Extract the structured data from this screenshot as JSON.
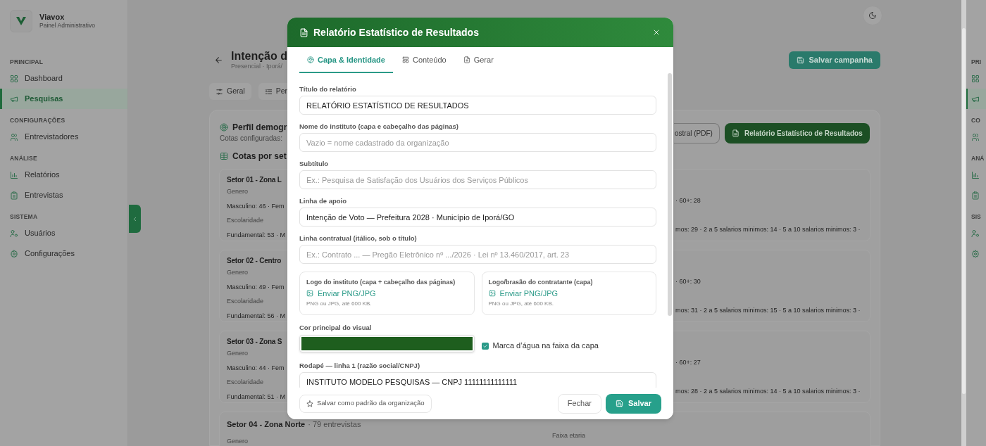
{
  "brand": {
    "name": "Viavox",
    "subtitle": "Painel Administrativo"
  },
  "sidebar": {
    "sections": [
      {
        "title": "PRINCIPAL",
        "items": [
          {
            "label": "Dashboard",
            "selected": false
          },
          {
            "label": "Pesquisas",
            "selected": true
          }
        ]
      },
      {
        "title": "CONFIGURAÇÕES",
        "items": [
          {
            "label": "Entrevistadores",
            "selected": false
          }
        ]
      },
      {
        "title": "ANÁLISE",
        "items": [
          {
            "label": "Relatórios",
            "selected": false
          },
          {
            "label": "Entrevistas",
            "selected": false
          }
        ]
      },
      {
        "title": "SISTEMA",
        "items": [
          {
            "label": "Usuários",
            "selected": false
          },
          {
            "label": "Configurações",
            "selected": false
          }
        ]
      }
    ]
  },
  "right_edge": {
    "sections": [
      {
        "title": "PRI",
        "items": [
          {
            "selected": false
          },
          {
            "selected": true
          }
        ]
      },
      {
        "title": "CO",
        "items": [
          {
            "selected": false
          }
        ]
      },
      {
        "title": "ANÁ",
        "items": [
          {
            "selected": false
          },
          {
            "selected": false
          }
        ]
      },
      {
        "title": "SIS",
        "items": [
          {
            "selected": false
          },
          {
            "selected": false
          }
        ]
      }
    ]
  },
  "page": {
    "title": "Intenção d",
    "subtitle": "Presencial · Iporá/",
    "save_button": "Salvar campanha",
    "tabs": [
      {
        "label": "Geral"
      },
      {
        "label": "Per"
      }
    ],
    "card": {
      "title": "Perfil demogr",
      "subtitle": "Cotas configuradas:",
      "pdf_button": "ostral (PDF)",
      "report_button": "Relatório Estatístico de Resultados",
      "section_title": "Cotas por set",
      "sectors": [
        {
          "kind": "split",
          "title": "Setor 01 - Zona L",
          "gender_label": "Genero",
          "gender_values": "Masculino: 46 · Fem",
          "age_values_tail": "· 60+: 28",
          "education_label": "Escolaridade",
          "education_values": "Fundamental: 53 · M",
          "education_values_tail": "mos: 29 · 2 a 5 salarios minimos: 14 · 5 a 10 salarios minimos: 3 ·"
        },
        {
          "kind": "split",
          "title": "Setor 02 - Centro",
          "gender_label": "Genero",
          "gender_values": "Masculino: 49 · Fem",
          "age_values_tail": "· 60+: 30",
          "education_label": "Escolaridade",
          "education_values": "Fundamental: 56 · M",
          "education_values_tail": "mos: 31 · 2 a 5 salarios minimos: 15 · 5 a 10 salarios minimos: 3 ·"
        },
        {
          "kind": "split",
          "title": "Setor 03 - Zona S",
          "gender_label": "Genero",
          "gender_values": "Masculino: 44 · Fem",
          "age_values_tail": "· 60+: 27",
          "education_label": "Escolaridade",
          "education_values": "Fundamental: 51 · M",
          "education_values_tail": "mos: 28 · 2 a 5 salarios minimos: 14 · 5 a 10 salarios minimos: 3 ·"
        },
        {
          "kind": "below",
          "title": "Setor 04 - Zona Norte",
          "count": "· 79 entrevistas",
          "gender_label": "Genero",
          "age_label": "Faixa etaria"
        }
      ]
    }
  },
  "modal": {
    "title": "Relatório Estatístico de Resultados",
    "tabs": [
      {
        "label": "Capa & Identidade",
        "selected": true
      },
      {
        "label": "Conteúdo",
        "selected": false
      },
      {
        "label": "Gerar",
        "selected": false
      }
    ],
    "fields": [
      {
        "label": "Título do relatório",
        "value": "RELATÓRIO ESTATÍSTICO DE RESULTADOS"
      },
      {
        "label": "Nome do instituto (capa e cabeçalho das páginas)",
        "placeholder": "Vazio = nome cadastrado da organização"
      },
      {
        "label": "Subtítulo",
        "placeholder": "Ex.: Pesquisa de Satisfação dos Usuários dos Serviços Públicos"
      },
      {
        "label": "Linha de apoio",
        "value": "Intenção de Voto — Prefeitura 2028 · Município de Iporá/GO"
      },
      {
        "label": "Linha contratual (itálico, sob o título)",
        "placeholder": "Ex.: Contrato ... — Pregão Eletrônico nº .../2026 · Lei nº 13.460/2017, art. 23"
      }
    ],
    "uploads": [
      {
        "label": "Logo do instituto (capa + cabeçalho das páginas)",
        "link": "Enviar PNG/JPG",
        "hint": "PNG ou JPG, até 600 KB."
      },
      {
        "label": "Logo/brasão do contratante (capa)",
        "link": "Enviar PNG/JPG",
        "hint": "PNG ou JPG, até 600 KB."
      }
    ],
    "color": {
      "label": "Cor principal do visual",
      "color": "#1e5e1e"
    },
    "watermark": {
      "label": "Marca d’água na faixa da capa",
      "checked": true
    },
    "footer_field": {
      "label": "Rodapé — linha 1 (razão social/CNPJ)",
      "value": "INSTITUTO MODELO PESQUISAS — CNPJ 11111111111111"
    },
    "default_button": "Salvar como padrão da organização",
    "close_button": "Fechar",
    "save_button": "Salvar"
  }
}
